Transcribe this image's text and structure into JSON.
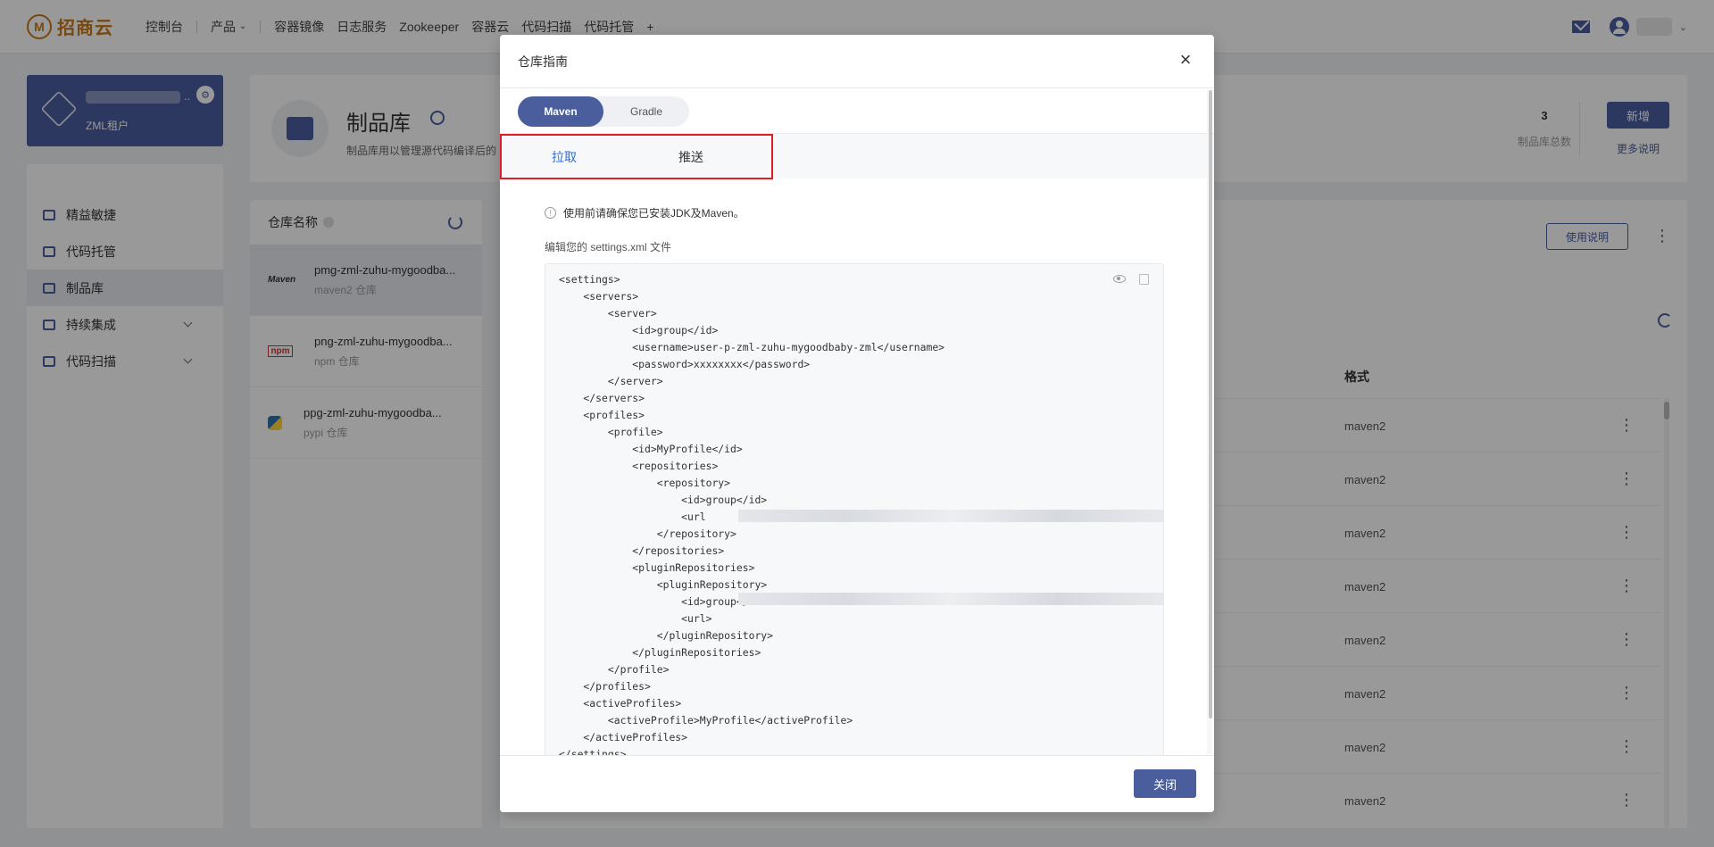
{
  "topnav": {
    "logo_text": "招商云",
    "items": [
      "控制台",
      "产品",
      "容器镜像",
      "日志服务",
      "Zookeeper",
      "容器云",
      "代码扫描",
      "代码托管"
    ],
    "plus": "+"
  },
  "tenant": {
    "name": "ZML租户",
    "dots": "..",
    "badge": "⚙"
  },
  "sidebar": {
    "items": [
      {
        "label": "精益敏捷",
        "active": false,
        "expandable": false
      },
      {
        "label": "代码托管",
        "active": false,
        "expandable": false
      },
      {
        "label": "制品库",
        "active": true,
        "expandable": false
      },
      {
        "label": "持续集成",
        "active": false,
        "expandable": true
      },
      {
        "label": "代码扫描",
        "active": false,
        "expandable": true
      }
    ]
  },
  "header": {
    "title": "制品库",
    "description": "制品库用以管理源代码编译后的",
    "count": "3",
    "count_label": "制品库总数",
    "new_button": "新增",
    "more_link": "更多说明"
  },
  "repo_list": {
    "header": "仓库名称",
    "items": [
      {
        "logo": "Maven",
        "name": "pmg-zml-zuhu-mygoodba...",
        "type": "maven2 仓库"
      },
      {
        "logo": "npm",
        "name": "png-zml-zuhu-mygoodba...",
        "type": "npm 仓库"
      },
      {
        "logo": "pypi",
        "name": "ppg-zml-zuhu-mygoodba...",
        "type": "pypi 仓库"
      }
    ]
  },
  "detail": {
    "usage_button": "使用说明",
    "format_header": "格式",
    "formats": [
      "maven2",
      "maven2",
      "maven2",
      "maven2",
      "maven2",
      "maven2",
      "maven2",
      "maven2"
    ]
  },
  "modal": {
    "title": "仓库指南",
    "close_symbol": "×",
    "build_tools": [
      "Maven",
      "Gradle"
    ],
    "tabs": [
      "拉取",
      "推送"
    ],
    "notice": "使用前请确保您已安装JDK及Maven。",
    "edit_label": "编辑您的 settings.xml 文件",
    "code_lines": [
      "<settings>",
      "    <servers>",
      "        <server>",
      "            <id>group</id>",
      "            <username>user-p-zml-zuhu-mygoodbaby-zml</username>",
      "            <password>xxxxxxxx</password>",
      "        </server>",
      "    </servers>",
      "    <profiles>",
      "        <profile>",
      "            <id>MyProfile</id>",
      "            <repositories>",
      "                <repository>",
      "                    <id>group</id>",
      "                    <url",
      "                </repository>",
      "            </repositories>",
      "            <pluginRepositories>",
      "                <pluginRepository>",
      "                    <id>group</id>",
      "                    <url>",
      "                </pluginRepository>",
      "            </pluginRepositories>",
      "        </profile>",
      "    </profiles>",
      "    <activeProfiles>",
      "        <activeProfile>MyProfile</activeProfile>",
      "    </activeProfiles>",
      "</settings>"
    ],
    "close_button": "关闭"
  },
  "colors": {
    "primary": "#4a5e9e",
    "link": "#2d6fd8",
    "highlight": "#e01e2b"
  }
}
